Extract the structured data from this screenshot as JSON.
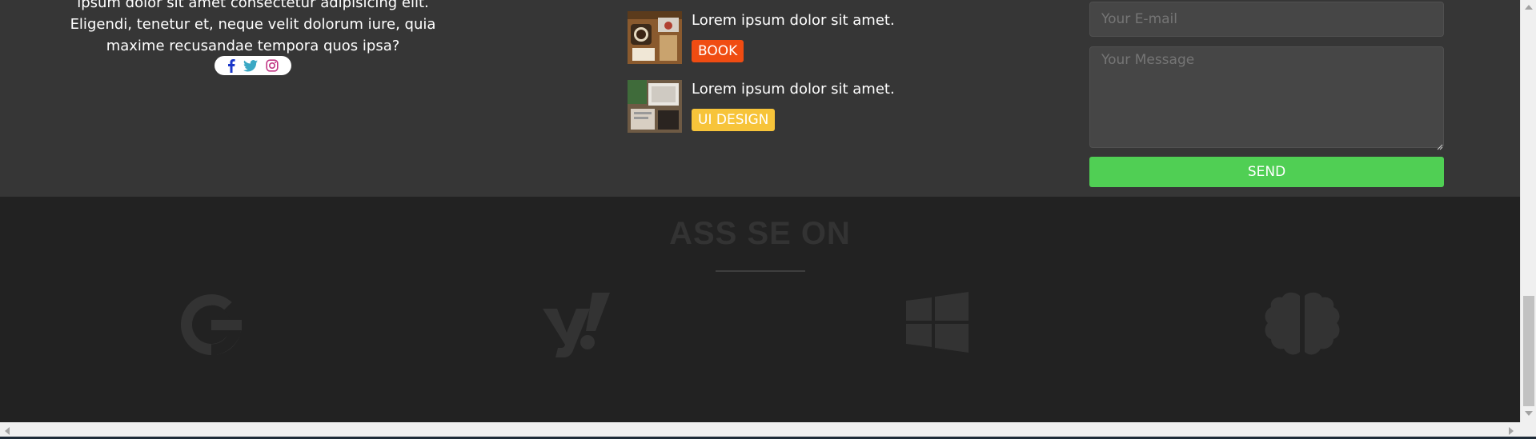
{
  "about": {
    "text": "ipsum dolor sit amet consectetur adipisicing elit. Eligendi, tenetur et, neque velit dolorum iure, quia maxime recusandae tempora quos ipsa?"
  },
  "social": {
    "icons": [
      "facebook-icon",
      "twitter-icon",
      "instagram-icon"
    ],
    "colors": {
      "facebook": "#1a37c9",
      "twitter": "#1da1f2",
      "instagram": "#c13584"
    }
  },
  "posts": [
    {
      "title": "Lorem ipsum dolor sit amet.",
      "tag": "BOOK",
      "tag_color": "#f04c12"
    },
    {
      "title": "Lorem ipsum dolor sit amet.",
      "tag": "UI DESIGN",
      "tag_color": "#f7c43a"
    }
  ],
  "contact": {
    "email_placeholder": "Your E-mail",
    "message_placeholder": "Your Message",
    "send_label": "SEND",
    "send_color": "#50cf54"
  },
  "seen_on": {
    "title": "ASS SE ON",
    "logos": [
      "google-icon",
      "yahoo-icon",
      "windows-icon",
      "brain-icon"
    ]
  }
}
